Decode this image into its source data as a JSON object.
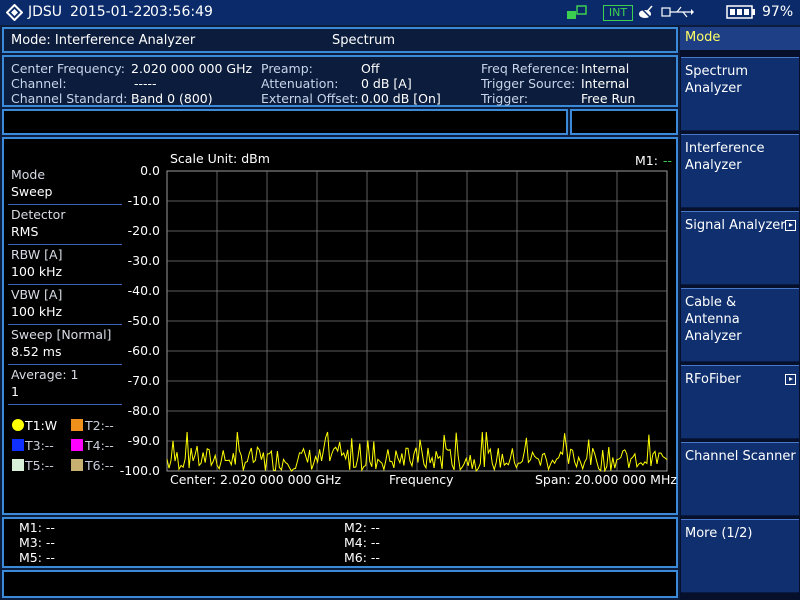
{
  "status_bar": {
    "brand": "JDSU",
    "date": "2015-01-22",
    "time": "03:56:49",
    "int_badge": "INT",
    "battery": "97%"
  },
  "mode_bar": {
    "mode": "Mode: Interference Analyzer",
    "view": "Spectrum"
  },
  "info": {
    "col1": [
      {
        "label": "Center Frequency:",
        "value": "2.020 000 000 GHz"
      },
      {
        "label": "Channel:",
        "value": "-----"
      },
      {
        "label": "Channel Standard:",
        "value": "Band 0 (800)"
      }
    ],
    "col2": [
      {
        "label": "Preamp:",
        "value": "Off"
      },
      {
        "label": "Attenuation:",
        "value": "0 dB [A]"
      },
      {
        "label": "External Offset:",
        "value": "0.00 dB [On]"
      }
    ],
    "col3": [
      {
        "label": "Freq Reference:",
        "value": "Internal"
      },
      {
        "label": "Trigger Source:",
        "value": "Internal"
      },
      {
        "label": "Trigger:",
        "value": "Free Run"
      }
    ]
  },
  "settings": [
    {
      "label": "Mode",
      "value": "Sweep"
    },
    {
      "label": "Detector",
      "value": "RMS"
    },
    {
      "label": "RBW [A]",
      "value": "100 kHz"
    },
    {
      "label": "VBW [A]",
      "value": "100 kHz"
    },
    {
      "label": "Sweep [Normal]",
      "value": "8.52 ms"
    },
    {
      "label": "Average: 1",
      "value": "1"
    }
  ],
  "traces": [
    {
      "label": "T1:W",
      "color": "#ffff00"
    },
    {
      "label": "T2:--",
      "color": "#f0901c"
    },
    {
      "label": "T3:--",
      "color": "#1030ff"
    },
    {
      "label": "T4:--",
      "color": "#ff00ff"
    },
    {
      "label": "T5:--",
      "color": "#d8f0d8"
    },
    {
      "label": "T6:--",
      "color": "#c8b070"
    }
  ],
  "chart": {
    "scale_unit": "Scale Unit: dBm",
    "m1_label": "M1:",
    "m1_value": "--",
    "center": "Center: 2.020 000 000 GHz",
    "xlabel": "Frequency",
    "span": "Span: 20.000 000 MHz"
  },
  "chart_data": {
    "type": "line",
    "ylim": [
      -100,
      0
    ],
    "yticks": [
      "0.0",
      "-10.0",
      "-20.0",
      "-30.0",
      "-40.0",
      "-50.0",
      "-60.0",
      "-70.0",
      "-80.0",
      "-90.0",
      "-100.0"
    ],
    "x_divisions": 10,
    "grid": true,
    "trace_color": "#ffff00",
    "noise_floor_dbm": -97,
    "noise_peak_dbm": -87,
    "points": 250
  },
  "markers": [
    {
      "label": "M1: --"
    },
    {
      "label": "M2: --"
    },
    {
      "label": "M3: --"
    },
    {
      "label": "M4: --"
    },
    {
      "label": "M5: --"
    },
    {
      "label": "M6: --"
    }
  ],
  "menu": {
    "title": "Mode",
    "items": [
      {
        "label": "Spectrum\nAnalyzer",
        "submenu": false
      },
      {
        "label": "Interference\nAnalyzer",
        "submenu": false
      },
      {
        "label": "Signal Analyzer",
        "submenu": true
      },
      {
        "label": "Cable &\nAntenna Analyzer",
        "submenu": false
      },
      {
        "label": "RFoFiber",
        "submenu": true
      },
      {
        "label": "Channel Scanner",
        "submenu": false
      },
      {
        "label": "More (1/2)",
        "submenu": false
      }
    ]
  }
}
